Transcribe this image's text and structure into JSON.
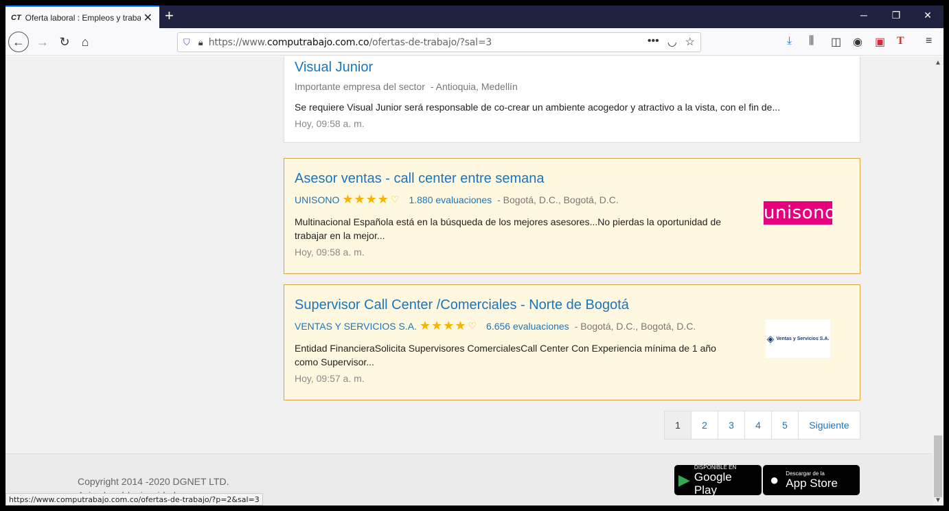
{
  "browser": {
    "tab_title": "Oferta laboral : Empleos y trabajo",
    "tab_icon": "CT",
    "url_prefix": "https://www.",
    "url_domain": "computrabajo.com.co",
    "url_path": "/ofertas-de-trabajo/?sal=3",
    "status_url": "https://www.computrabajo.com.co/ofertas-de-trabajo/?p=2&sal=3"
  },
  "jobs": [
    {
      "title": "Visual Junior",
      "company": "Importante empresa del sector",
      "location": "- Antioquia, Medellín",
      "description": "Se requiere Visual Junior será responsable de co-crear un ambiente acogedor y atractivo a la vista, con el fin de...",
      "date": "Hoy, 09:58 a. m."
    },
    {
      "title": "Asesor ventas - call center entre semana",
      "company": "UNISONO",
      "stars": "★★★★",
      "evaluations": "1.880 evaluaciones",
      "location": "- Bogotá, D.C., Bogotá, D.C.",
      "description": "Multinacional Española está en la búsqueda de los mejores asesores...No pierdas la oportunidad de trabajar en la mejor...",
      "date": "Hoy, 09:58 a. m.",
      "logo_text": "unisono"
    },
    {
      "title": "Supervisor Call Center /Comerciales - Norte de Bogotá",
      "company": "VENTAS Y SERVICIOS S.A.",
      "stars": "★★★★",
      "evaluations": "6.656 evaluaciones",
      "location": "- Bogotá, D.C., Bogotá, D.C.",
      "description": "Entidad FinancieraSolicita Supervisores ComercialesCall Center Con Experiencia mínima de 1 año como Supervisor...",
      "date": "Hoy, 09:57 a. m.",
      "logo_text": "Ventas y Servicios S.A."
    }
  ],
  "pagination": {
    "pages": [
      "1",
      "2",
      "3",
      "4",
      "5"
    ],
    "next": "Siguiente",
    "active": "1"
  },
  "footer": {
    "copyright": "Copyright 2014 -2020 DGNET LTD.",
    "legal": "Aviso legal / privacidad",
    "google_small": "DISPONIBLE EN",
    "google_big": "Google Play",
    "apple_small": "Descargar de la",
    "apple_big": "App Store"
  },
  "colors": {
    "accent": "#1a75bb",
    "featured_bg": "#fff8e1",
    "star": "#f6b400",
    "unisono_pink": "#e6007e"
  }
}
